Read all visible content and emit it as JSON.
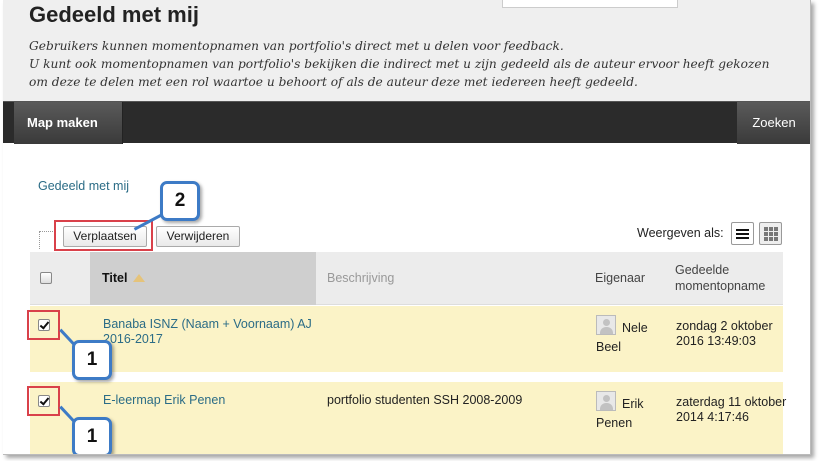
{
  "page": {
    "title": "Gedeeld met mij",
    "description": [
      "Gebruikers kunnen momentopnamen van portfolio's direct met u delen voor feedback.",
      "U kunt ook momentopnamen van portfolio's bekijken die indirect met u zijn gedeeld als de auteur ervoor heeft gekozen",
      "om deze te delen met een rol waartoe u behoort of als de auteur deze met iedereen heeft gedeeld."
    ]
  },
  "toolbar": {
    "left_button": "Map maken",
    "right_button": "Zoeken"
  },
  "breadcrumb": "Gedeeld met mij",
  "actions": {
    "move": "Verplaatsen",
    "delete": "Verwijderen"
  },
  "view": {
    "label": "Weergeven als:"
  },
  "table": {
    "headers": {
      "title": "Titel",
      "description": "Beschrijving",
      "owner": "Eigenaar",
      "date": "Gedeelde momentopname"
    },
    "rows": [
      {
        "title": "Banaba ISNZ (Naam + Voornaam) AJ 2016-2017",
        "description": "",
        "owner": "Nele Beel",
        "date": "zondag 2 oktober 2016 13:49:03",
        "checked": true
      },
      {
        "title": "E-leermap Erik Penen",
        "description": "portfolio studenten SSH 2008-2009",
        "owner": "Erik Penen",
        "date": "zaterdag 11 oktober 2014 4:17:46",
        "checked": true
      }
    ]
  },
  "callouts": {
    "move_step": "2",
    "select_step_1": "1",
    "select_step_2": "1"
  },
  "colors": {
    "highlight_border": "#d9414a",
    "callout_border": "#3d7bc6",
    "row_bg": "#fbf3c7",
    "link": "#2b6c86",
    "toolbar_bg": "#2b2b2b"
  }
}
